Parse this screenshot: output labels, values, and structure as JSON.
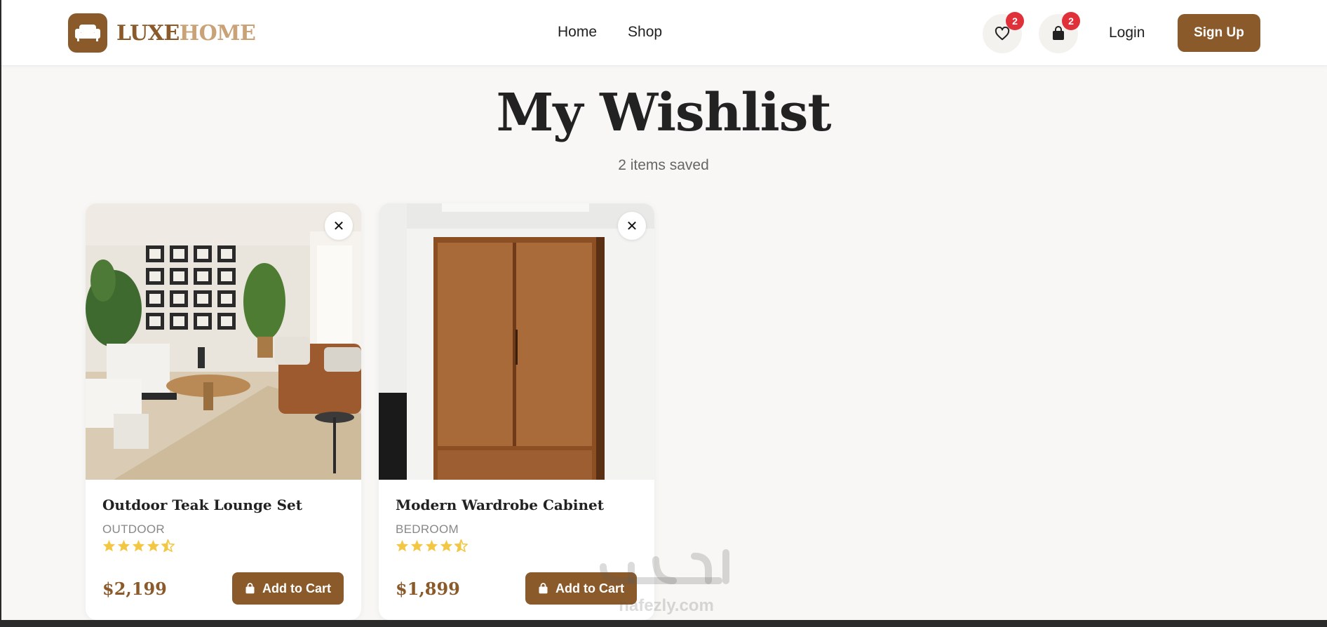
{
  "brand": {
    "part1": "LUXE",
    "part2": "HOME"
  },
  "nav": {
    "home": "Home",
    "shop": "Shop"
  },
  "header": {
    "wishlist_count": "2",
    "cart_count": "2",
    "login": "Login",
    "signup": "Sign Up"
  },
  "page": {
    "title": "My Wishlist",
    "subtitle": "2 items saved"
  },
  "items": [
    {
      "name": "Outdoor Teak Lounge Set",
      "category": "OUTDOOR",
      "rating": 4.5,
      "price": "$2,199",
      "cta": "Add to Cart"
    },
    {
      "name": "Modern Wardrobe Cabinet",
      "category": "BEDROOM",
      "rating": 4.5,
      "price": "$1,899",
      "cta": "Add to Cart"
    }
  ],
  "watermark": "nafezly.com",
  "colors": {
    "brand": "#8a5a2b",
    "brand_light": "#c9a277",
    "badge": "#e0303a",
    "star": "#f2c744",
    "background": "#f8f7f5"
  }
}
